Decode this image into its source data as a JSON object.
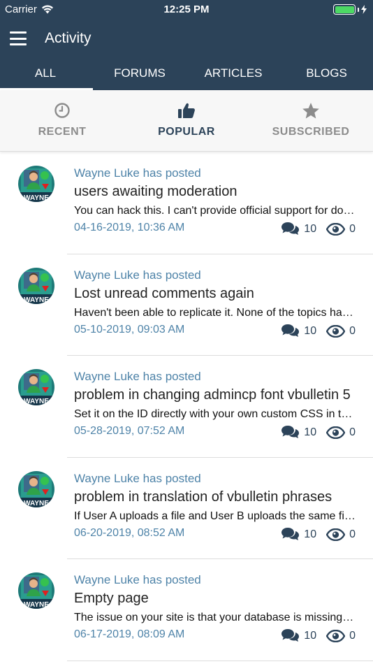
{
  "status_bar": {
    "carrier": "Carrier",
    "time": "12:25 PM",
    "battery_level": 1.0,
    "battery_color": "#4cd964"
  },
  "header": {
    "title": "Activity",
    "menu_icon": "hamburger-icon",
    "background": "#2c4359"
  },
  "tabs": [
    {
      "label": "ALL",
      "active": true
    },
    {
      "label": "FORUMS",
      "active": false
    },
    {
      "label": "ARTICLES",
      "active": false
    },
    {
      "label": "BLOGS",
      "active": false
    }
  ],
  "subtabs": [
    {
      "label": "RECENT",
      "icon": "clock-icon",
      "active": false
    },
    {
      "label": "POPULAR",
      "icon": "thumbs-up-icon",
      "active": true
    },
    {
      "label": "SUBSCRIBED",
      "icon": "star-icon",
      "active": false
    }
  ],
  "posts": [
    {
      "poster": "Wayne Luke has posted",
      "title": "users awaiting moderation",
      "snippet": "You can hack this. I can't provide official support for doing so but it isn't hard.",
      "date": "04-16-2019, 10:36 AM",
      "comments": "10",
      "views": "0"
    },
    {
      "poster": "Wayne Luke has posted",
      "title": "Lost unread comments again",
      "snippet": "Haven't been able to replicate it. None of the topics have been updated since.",
      "date": "05-10-2019, 09:03 AM",
      "comments": "10",
      "views": "0"
    },
    {
      "poster": "Wayne Luke has posted",
      "title": "problem in changing admincp font vbulletin 5",
      "snippet": "Set it on the ID directly with your own custom CSS in the template.",
      "date": "05-28-2019, 07:52 AM",
      "comments": "10",
      "views": "0"
    },
    {
      "poster": "Wayne Luke has posted",
      "title": "problem in translation of vbulletin phrases",
      "snippet": "If User A uploads a file and User B uploads the same file, it is stored once.",
      "date": "06-20-2019, 08:52 AM",
      "comments": "10",
      "views": "0"
    },
    {
      "poster": "Wayne Luke has posted",
      "title": "Empty page",
      "snippet": "The issue on your site is that your database is missing required tables.",
      "date": "06-17-2019, 08:09 AM",
      "comments": "10",
      "views": "0"
    }
  ],
  "avatar_text": "WAYNE",
  "colors": {
    "accent": "#2c4359",
    "link": "#4e83a8",
    "inactive": "#8c8c8c"
  }
}
